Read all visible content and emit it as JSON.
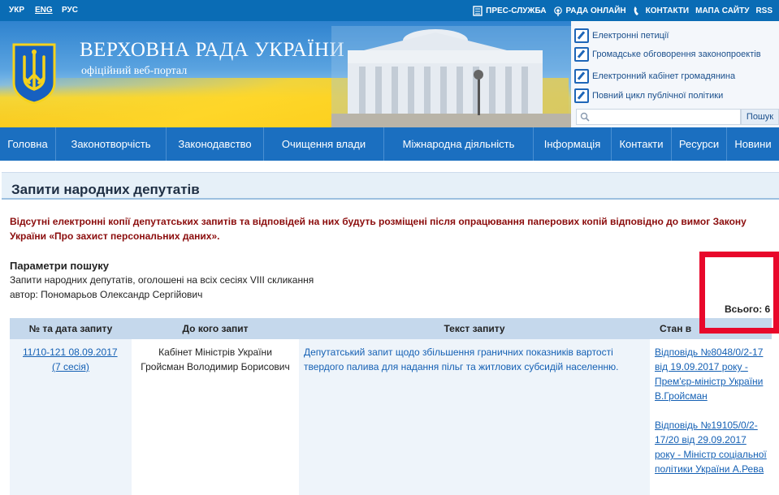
{
  "topbar": {
    "languages": [
      "УКР",
      "ENG",
      "РУС"
    ],
    "links": [
      "ПРЕС-СЛУЖБА",
      "РАДА ОНЛАЙН",
      "КОНТАКТИ",
      "МАПА САЙТУ",
      "RSS"
    ]
  },
  "header": {
    "title": "ВЕРХОВНА РАДА УКРАЇНИ",
    "subtitle": "офіційний веб-портал",
    "side_links": [
      "Електронні петиції",
      "Громадське обговорення законопроектів",
      "Електронний кабінет громадянина",
      "Повний цикл публічної політики"
    ],
    "search_placeholder": "",
    "search_button": "Пошук"
  },
  "nav": [
    "Головна",
    "Законотворчість",
    "Законодавство",
    "Очищення влади",
    "Міжнародна діяльність",
    "Інформація",
    "Контакти",
    "Ресурси",
    "Новини"
  ],
  "page": {
    "title": "Запити народних депутатів",
    "warning": "Відсутні електронні копії депутатських запитів та відповідей на них будуть розміщені після опрацювання паперових копій відповідно до вимог Закону України «Про захист персональних даних».",
    "params_title": "Параметри пошуку",
    "params_line1": "Запити народних депутатів, оголошені на всіх сесіях VIII скликання",
    "params_line2": "автор: Пономарьов Олександр Сергійович",
    "total": "Всього: 6"
  },
  "table": {
    "headers": [
      "№ та дата запиту",
      "До кого запит",
      "Текст запиту",
      "Стан в"
    ],
    "rows": [
      {
        "number_date": "11/10-121 08.09.2017",
        "session": "(7 сесія)",
        "to_whom_line1": "Кабінет Міністрів України",
        "to_whom_line2": "Гройсман Володимир Борисович",
        "text_line1": "Депутатський запит щодо збільшення граничних показників вартості",
        "text_line2": "твердого палива для надання пільг та житлових субсидій населенню.",
        "status1": [
          "Відповідь №8048/0/2-17",
          "від 19.09.2017 року -",
          "Прем'єр-міністр України",
          "В.Гройсман"
        ],
        "status2": [
          "Відповідь №19105/0/2-",
          "17/20 від 29.09.2017",
          "року - Міністр соціальної",
          "політики України А.Рева"
        ]
      }
    ]
  },
  "colors": {
    "topbar": "#0a6cb5",
    "nav": "#1b6fc0",
    "warning": "#8b0c0c",
    "link": "#1460b4",
    "highlight": "#e8082b"
  }
}
